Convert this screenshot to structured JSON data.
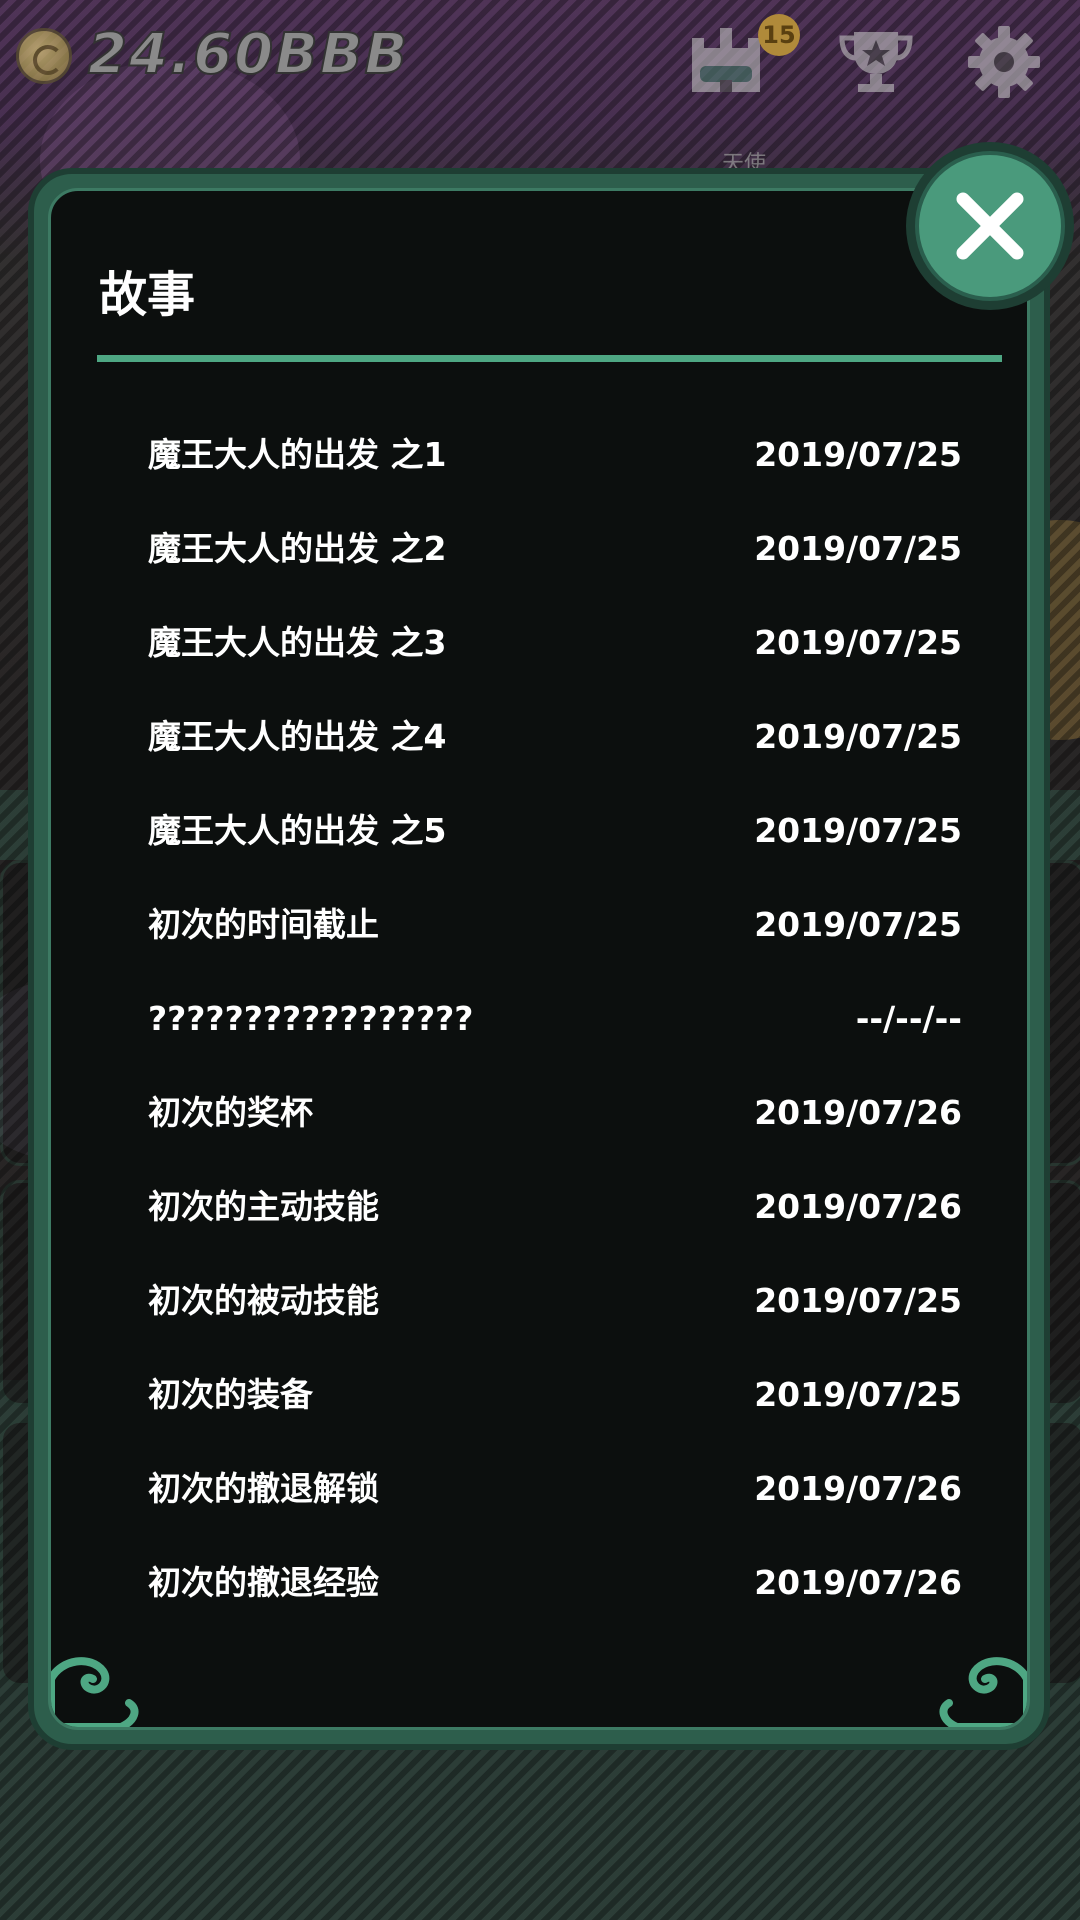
{
  "hud": {
    "coin_amount": "24.60BBB",
    "castle_badge": "15",
    "icons": [
      "coin-icon",
      "castle-icon",
      "trophy-icon",
      "gear-icon"
    ],
    "faint_label": "天使"
  },
  "dialog": {
    "title": "故事",
    "close_icon": "close-icon",
    "accent_color": "#4ea783",
    "frame_color": "#2d5e4c",
    "stories": [
      {
        "name": "魔王大人的出发 之1",
        "date": "2019/07/25"
      },
      {
        "name": "魔王大人的出发 之2",
        "date": "2019/07/25"
      },
      {
        "name": "魔王大人的出发 之3",
        "date": "2019/07/25"
      },
      {
        "name": "魔王大人的出发 之4",
        "date": "2019/07/25"
      },
      {
        "name": "魔王大人的出发 之5",
        "date": "2019/07/25"
      },
      {
        "name": "初次的时间截止",
        "date": "2019/07/25"
      },
      {
        "name": "?????????????????",
        "date": "--/--/--"
      },
      {
        "name": "初次的奖杯",
        "date": "2019/07/26"
      },
      {
        "name": "初次的主动技能",
        "date": "2019/07/26"
      },
      {
        "name": "初次的被动技能",
        "date": "2019/07/25"
      },
      {
        "name": "初次的装备",
        "date": "2019/07/25"
      },
      {
        "name": "初次的撤退解锁",
        "date": "2019/07/26"
      },
      {
        "name": "初次的撤退经验",
        "date": "2019/07/26"
      }
    ]
  }
}
